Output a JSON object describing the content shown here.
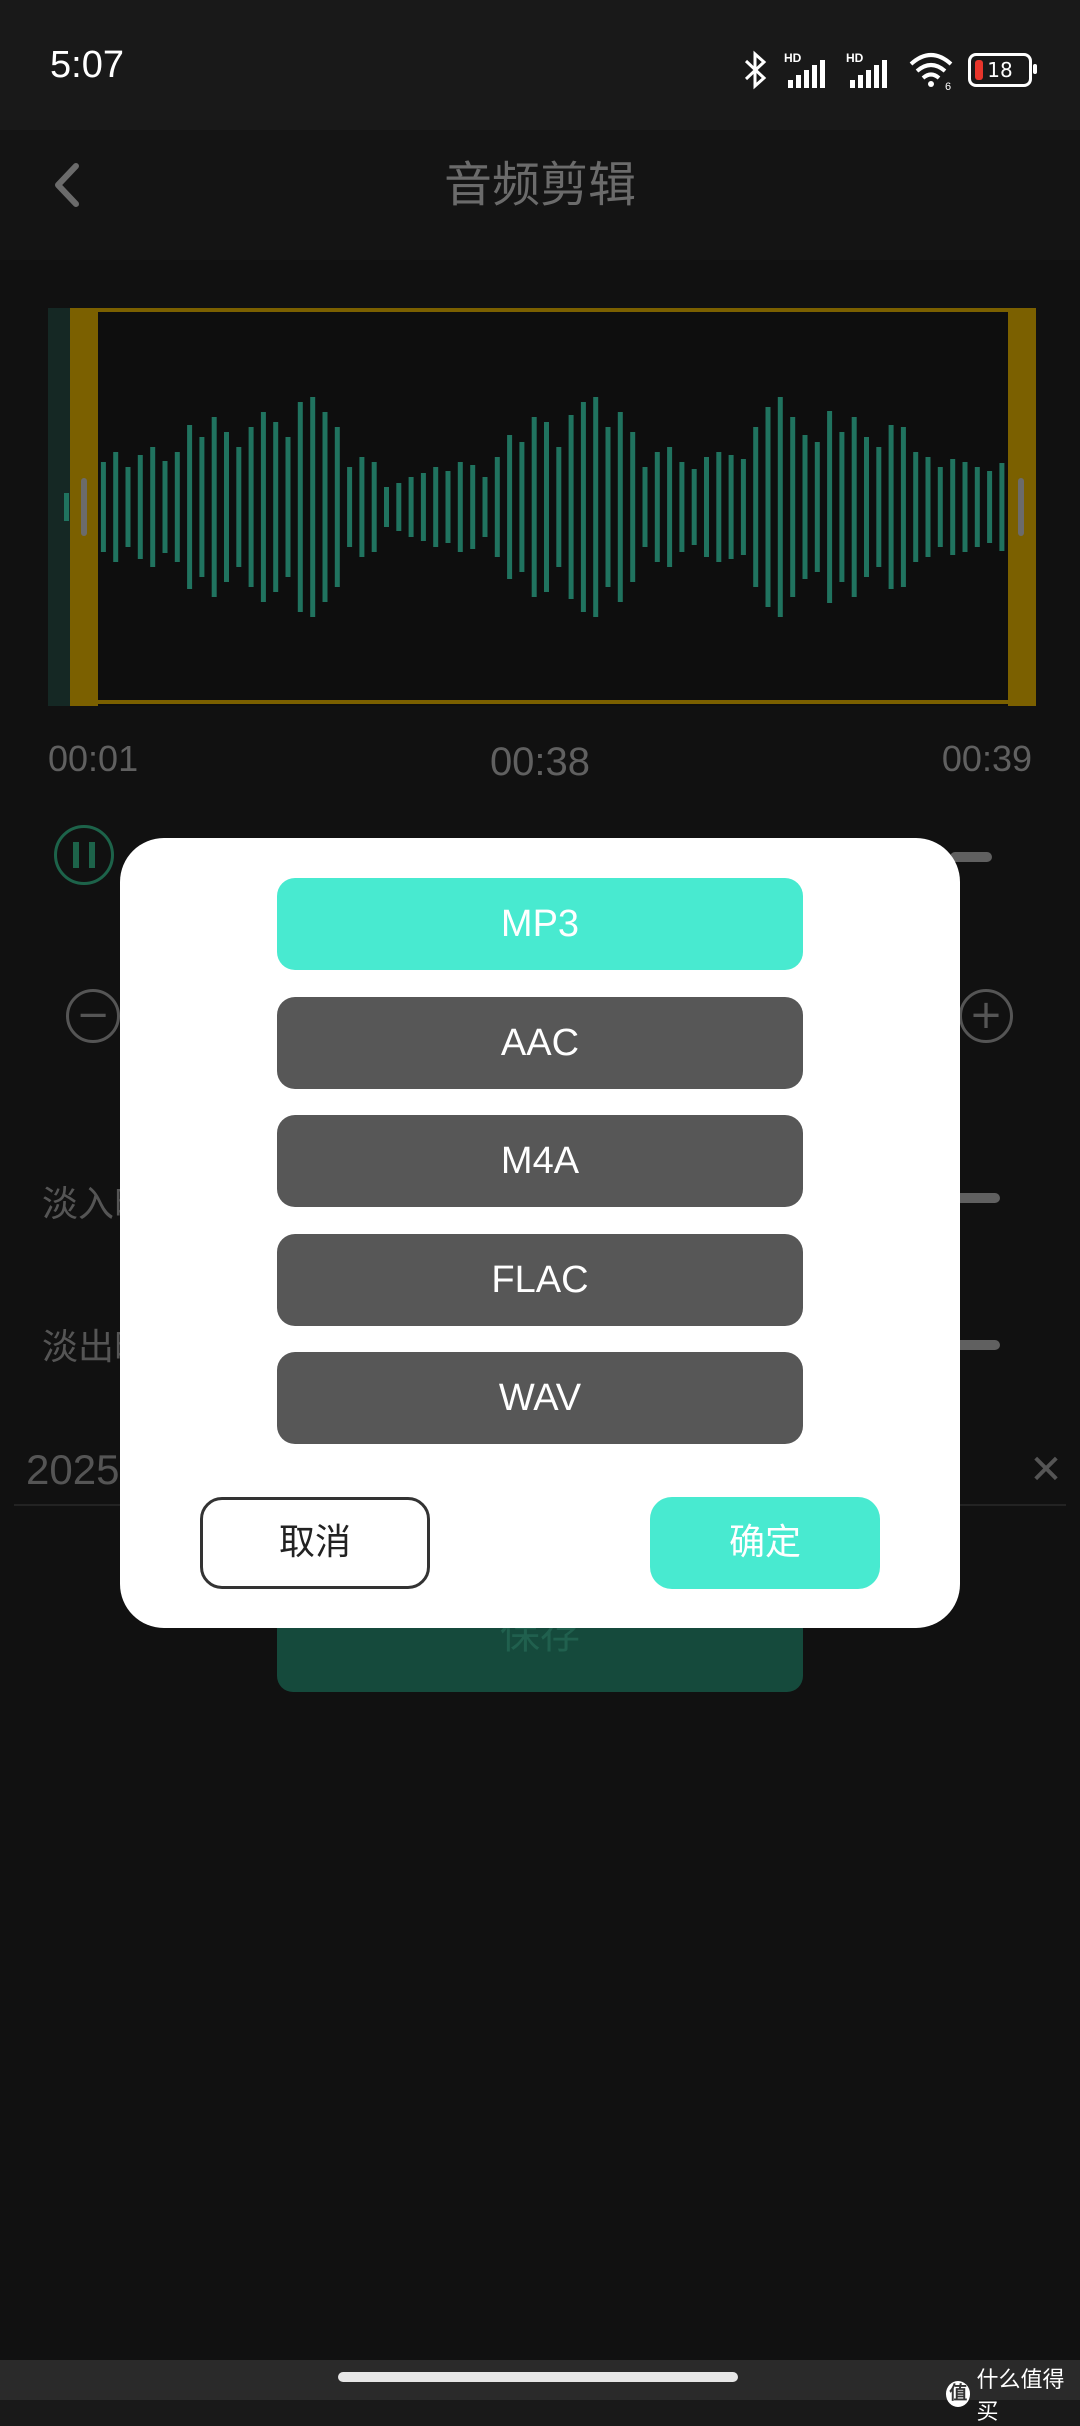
{
  "status_bar": {
    "time": "5:07",
    "battery": "18",
    "icons": [
      "bluetooth-icon",
      "hd-signal-icon",
      "hd-signal-icon",
      "wifi-icon",
      "battery-icon"
    ],
    "hd_label": "HD",
    "wifi_badge": "6"
  },
  "header": {
    "title": "音频剪辑"
  },
  "editor": {
    "start_time": "00:01",
    "current_time": "00:38",
    "end_time": "00:39",
    "fade_in_label": "淡入时",
    "fade_out_label": "淡出时",
    "filename": "2025",
    "save_label": "保存"
  },
  "dialog": {
    "formats": [
      "MP3",
      "AAC",
      "M4A",
      "FLAC",
      "WAV"
    ],
    "selected_format": "MP3",
    "cancel_label": "取消",
    "confirm_label": "确定"
  },
  "watermark": {
    "logo": "值",
    "text": "什么值得买"
  },
  "colors": {
    "accent": "#48ead0",
    "wave": "#2fa588",
    "frame": "#b08a00",
    "button_gray": "#575757"
  }
}
